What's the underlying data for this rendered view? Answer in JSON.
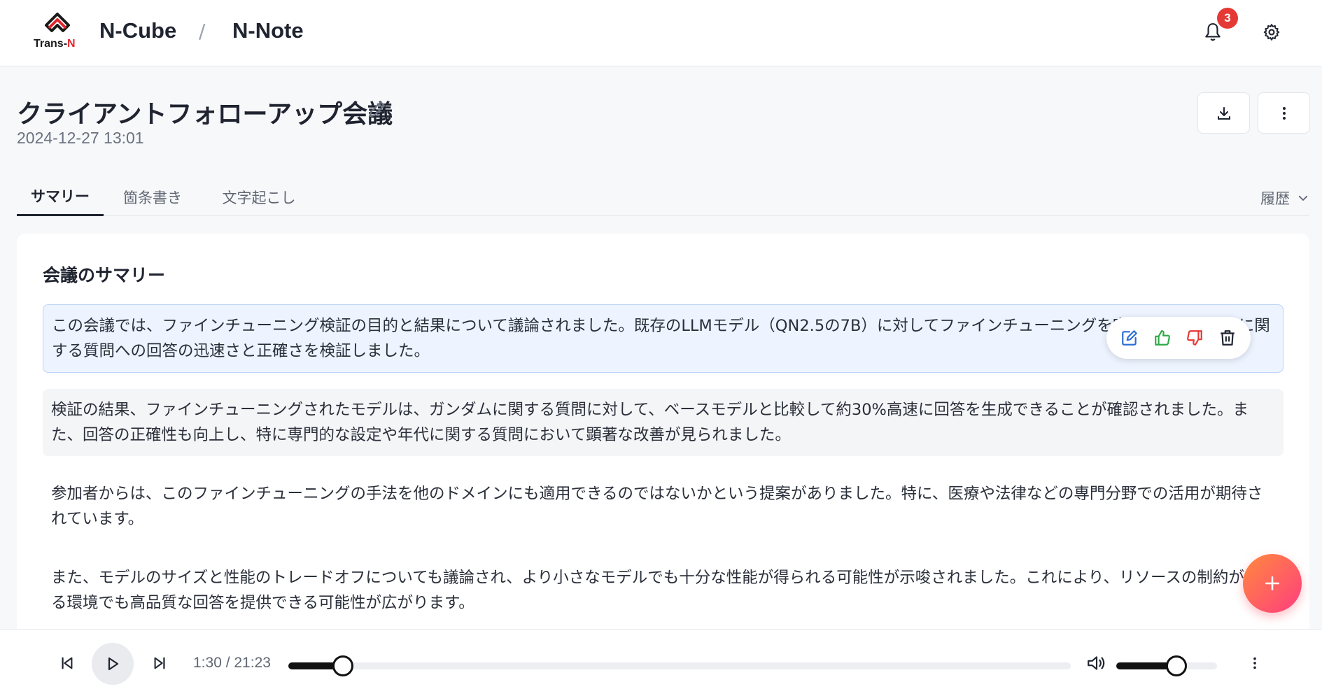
{
  "header": {
    "logo_text_main": "Trans-",
    "logo_text_accent": "N",
    "breadcrumb": [
      "N-Cube",
      "N-Note"
    ],
    "breadcrumb_separator": "/",
    "notification_count": "3"
  },
  "page": {
    "title": "クライアントフォローアップ会議",
    "date": "2024-12-27 13:01"
  },
  "tabs": [
    {
      "label": "サマリー",
      "active": true
    },
    {
      "label": "箇条書き",
      "active": false
    },
    {
      "label": "文字起こし",
      "active": false
    }
  ],
  "history_label": "履歴",
  "summary": {
    "heading": "会議のサマリー",
    "paragraphs": [
      "この会議では、ファインチューニング検証の目的と結果について議論されました。既存のLLMモデル（QN2.5の7B）に対してファインチューニングを実施し、ガンダムに関する質問への回答の迅速さと正確さを検証しました。",
      "検証の結果、ファインチューニングされたモデルは、ガンダムに関する質問に対して、ベースモデルと比較して約30%高速に回答を生成できることが確認されました。また、回答の正確性も向上し、特に専門的な設定や年代に関する質問において顕著な改善が見られました。",
      "参加者からは、このファインチューニングの手法を他のドメインにも適用できるのではないかという提案がありました。特に、医療や法律などの専門分野での活用が期待されています。",
      "また、モデルのサイズと性能のトレードオフについても議論され、より小さなモデルでも十分な性能が得られる可能性が示唆されました。これにより、リソースの制約がある環境でも高品質な回答を提供できる可能性が広がります。"
    ]
  },
  "player": {
    "time_display": "1:30 / 21:23",
    "progress_fraction": 0.0701,
    "volume_fraction": 0.6
  },
  "colors": {
    "accent_gradient_start": "#ff8a3d",
    "accent_gradient_end": "#ff3d7f",
    "badge": "#e53935",
    "selection_bg": "#edf4ff",
    "like": "#2eaa4a",
    "dislike": "#e53935",
    "edit": "#2b6fd6"
  },
  "icons": {
    "notification": "bell-icon",
    "settings": "gear-icon",
    "download": "download-icon",
    "more": "more-vertical-icon",
    "edit_title": "pencil-icon",
    "history": "chevron-down-icon",
    "toolbar": [
      "edit-icon",
      "thumbs-up-icon",
      "thumbs-down-icon",
      "trash-icon"
    ],
    "add": "plus-icon",
    "player": [
      "skip-back-icon",
      "play-icon",
      "skip-forward-icon",
      "volume-icon",
      "more-vertical-icon"
    ]
  }
}
